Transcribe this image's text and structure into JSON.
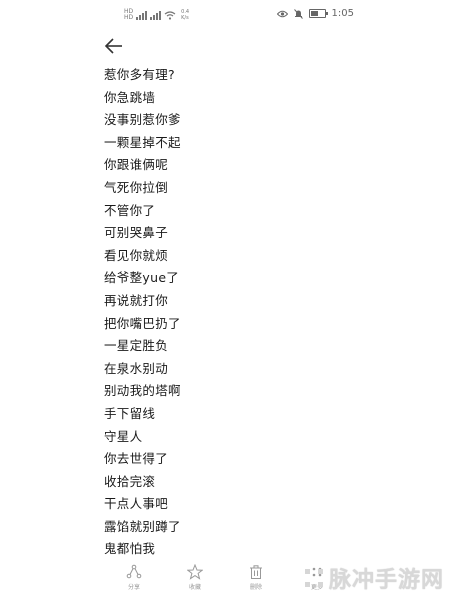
{
  "status_bar": {
    "sim_top": "HD",
    "sim_bottom": "HD",
    "net_speed_top": "0.4",
    "net_speed_bottom": "K/s",
    "time": "1:05",
    "battery_level": 0.55
  },
  "note": {
    "lines": [
      "惹你多有理?",
      "你急跳墙",
      "没事别惹你爹",
      "一颗星掉不起",
      "你跟谁俩呢",
      "气死你拉倒",
      "不管你了",
      "可别哭鼻子",
      "看见你就烦",
      "给爷整yue了",
      "再说就打你",
      "把你嘴巴扔了",
      "一星定胜负",
      "在泉水别动",
      "别动我的塔啊",
      "手下留线",
      "守星人",
      "你去世得了",
      "收拾完滚",
      "干点人事吧",
      "露馅就别蹲了",
      "鬼都怕我"
    ]
  },
  "toolbar": {
    "share_label": "分享",
    "favorite_label": "收藏",
    "delete_label": "删除",
    "more_label": "更多"
  },
  "watermark": {
    "text": "脉冲手游网"
  }
}
